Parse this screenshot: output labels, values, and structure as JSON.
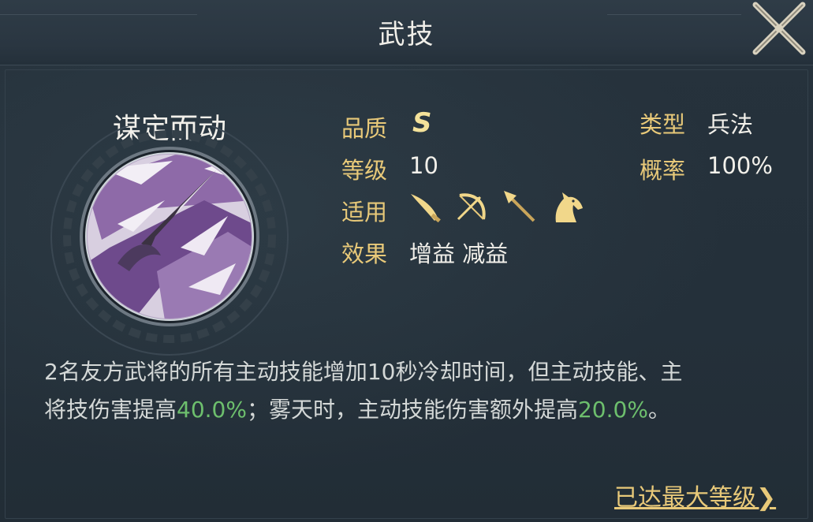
{
  "header": {
    "title": "武技"
  },
  "skill": {
    "name": "谋定而动",
    "icon": "lightning-spear-icon"
  },
  "attributes": {
    "quality": {
      "label": "品质",
      "value": "S"
    },
    "level": {
      "label": "等级",
      "value": "10"
    },
    "applicable": {
      "label": "适用",
      "icons": [
        "sword-icon",
        "bow-icon",
        "spear-icon",
        "horse-icon"
      ]
    },
    "effect": {
      "label": "效果",
      "value": "增益 减益"
    },
    "type": {
      "label": "类型",
      "value": "兵法"
    },
    "probability": {
      "label": "概率",
      "value": "100%"
    }
  },
  "description": {
    "line1": "2名友方武将的所有主动技能增加10秒冷却时间，但主动技能、主",
    "line2_part1": "将技伤害提高",
    "line2_highlight1": "40.0%",
    "line2_part2": "；雾天时，主动技能伤害额外提高",
    "line2_highlight2": "20.0%",
    "line2_part3": "。"
  },
  "footer": {
    "max_level": "已达最大等级❯"
  },
  "colors": {
    "label_gold": "#e8c979",
    "highlight_green": "#6dbf6d",
    "background": "#25313b"
  }
}
